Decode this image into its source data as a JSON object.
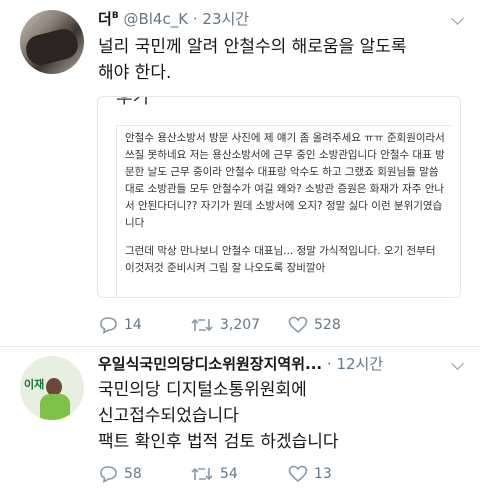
{
  "tweets": [
    {
      "name": "더",
      "name_sup": "B",
      "handle": "@Bl4c_K",
      "dot": "·",
      "time": "23시간",
      "text_lines": [
        "널리 국민께 알려 안철수의 해로움을 알도록",
        "해야 한다."
      ],
      "card": {
        "top_fragment": "후기",
        "paragraphs": [
          "안철수 용산소방서 방문 사진에 제 얘기 좀 올려주세요 ㅠㅠ 준회원이라서 쓰질 못하네요 저는 용산소방서에 근무 중인 소방관입니다 안철수 대표 방문한 날도 근무 중이라 안철수 대표랑 악수도 하고 그랬죠 회원님들 말씀대로 소방관들 모두 안철수가 여길 왜와? 소방관 증원은 화재가 자주 안나서 안된다더니?? 자기가 뭔데 소방서에 오지? 정말 싫다 이런 분위기였습니다",
          "그런데 막상 만나보니 안철수 대표님... 정말 가식적입니다. 오기 전부터 이것저것 준비시켜 그림 잘 나오도록 장비깔아"
        ]
      },
      "actions": {
        "reply": "14",
        "retweet": "3,207",
        "like": "528"
      }
    },
    {
      "name": "우일식국민의당디소위원장지역위...",
      "dot": "·",
      "time": "12시간",
      "text_lines": [
        "국민의당 디지털소통위원회에",
        "신고접수되었습니다",
        "팩트 확인후 법적 검토 하겠습니다"
      ],
      "avatar_text": "이재",
      "actions": {
        "reply": "58",
        "retweet": "54",
        "like": "13"
      }
    }
  ]
}
